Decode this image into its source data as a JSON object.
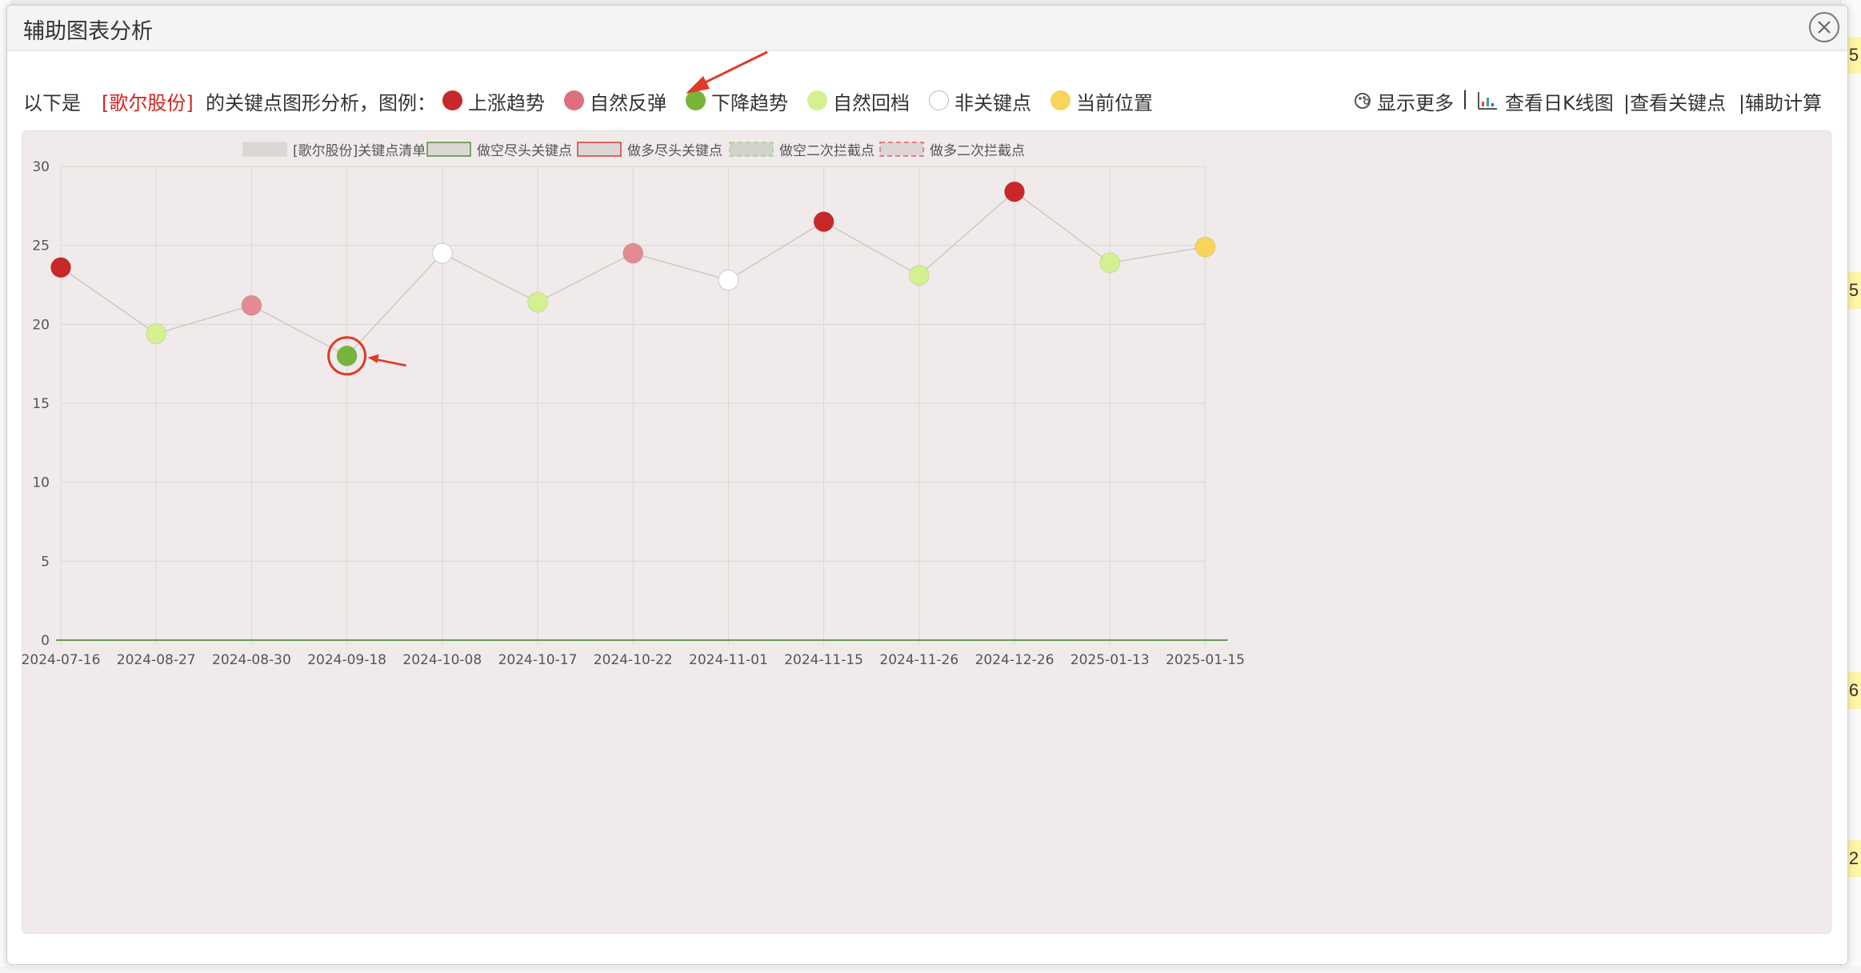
{
  "dialog": {
    "title": "辅助图表分析"
  },
  "legend_bar": {
    "prefix": "以下是",
    "stock": "[歌尔股份]",
    "suffix": "的关键点图形分析，图例：",
    "items": [
      {
        "label": "上涨趋势",
        "color": "#c9282b"
      },
      {
        "label": "自然反弹",
        "color": "#dd6f7e"
      },
      {
        "label": "下降趋势",
        "color": "#77b53a"
      },
      {
        "label": "自然回档",
        "color": "#d3f191"
      },
      {
        "label": "非关键点",
        "color": "#ffffff"
      },
      {
        "label": "当前位置",
        "color": "#f7d55a"
      }
    ]
  },
  "toolbar": {
    "show_more": "显示更多",
    "sep": "|",
    "kline": "查看日K线图",
    "keypoints": "|查看关键点",
    "calc": "|辅助计算"
  },
  "side_badges": [
    "5",
    "5",
    "6",
    "2"
  ],
  "chart_data": {
    "type": "scatter",
    "series_legend": [
      {
        "name": "[歌尔股份]关键点清单",
        "fill": "#dcd6d5",
        "stroke": "#dcd6d5",
        "dashed": false
      },
      {
        "name": "做空尽头关键点",
        "fill": "#dcd6d5",
        "stroke": "#4a8a2a",
        "dashed": false
      },
      {
        "name": "做多尽头关键点",
        "fill": "#dcd6d5",
        "stroke": "#d53030",
        "dashed": false
      },
      {
        "name": "做空二次拦截点",
        "fill": "#cfd3c8",
        "stroke": "#a5cf85",
        "dashed": true
      },
      {
        "name": "做多二次拦截点",
        "fill": "#dcd6d5",
        "stroke": "#e06060",
        "dashed": true
      }
    ],
    "categories": [
      "2024-07-16",
      "2024-08-27",
      "2024-08-30",
      "2024-09-18",
      "2024-10-08",
      "2024-10-17",
      "2024-10-22",
      "2024-11-01",
      "2024-11-15",
      "2024-11-26",
      "2024-12-26",
      "2025-01-13",
      "2025-01-15"
    ],
    "values": [
      23.6,
      19.4,
      21.2,
      18.0,
      24.5,
      21.4,
      24.5,
      22.8,
      26.5,
      23.1,
      28.4,
      23.9,
      24.9
    ],
    "point_colors": [
      "#c9282b",
      "#d3f191",
      "#e38b93",
      "#77b53a",
      "#ffffff",
      "#d3f191",
      "#e38b93",
      "#ffffff",
      "#c9282b",
      "#d3f191",
      "#c9282b",
      "#d3f191",
      "#f7d55a"
    ],
    "yticks": [
      0,
      5,
      10,
      15,
      20,
      25,
      30
    ],
    "ylim": [
      0,
      30
    ],
    "grid": true,
    "highlighted_point_index": 3
  }
}
